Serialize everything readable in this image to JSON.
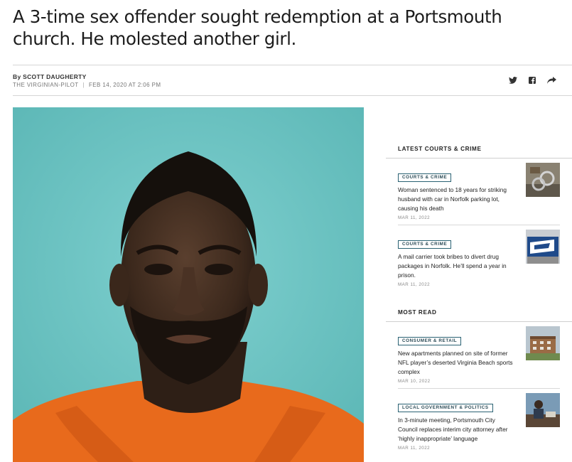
{
  "article": {
    "headline": "A 3-time sex offender sought redemption at a Portsmouth church. He molested another girl.",
    "author": "By SCOTT DAUGHERTY",
    "publication": "THE VIRGINIAN-PILOT",
    "date": "FEB 14, 2020 AT 2:06 PM",
    "share_icons": [
      "twitter-icon",
      "facebook-icon",
      "share-arrow-icon"
    ]
  },
  "sidebar": {
    "latest": {
      "title": "LATEST COURTS & CRIME",
      "items": [
        {
          "tag": "COURTS & CRIME",
          "title": "Woman sentenced to 18 years for striking husband with car in Norfolk parking lot, causing his death",
          "date": "MAR 11, 2022",
          "thumb": "handcuffs-photo"
        },
        {
          "tag": "COURTS & CRIME",
          "title": "A mail carrier took bribes to divert drug packages in Norfolk. He’ll spend a year in prison.",
          "date": "MAR 11, 2022",
          "thumb": "usps-sign-photo"
        }
      ]
    },
    "most_read": {
      "title": "MOST READ",
      "items": [
        {
          "tag": "CONSUMER & RETAIL",
          "title": "New apartments planned on site of former NFL player’s deserted Virginia Beach sports complex",
          "date": "MAR 10, 2022",
          "thumb": "apartments-photo"
        },
        {
          "tag": "LOCAL GOVERNMENT & POLITICS",
          "title": "In 3-minute meeting, Portsmouth City Council replaces interim city attorney after ‘highly inappropriate’ language",
          "date": "MAR 11, 2022",
          "thumb": "council-photo"
        }
      ]
    }
  },
  "colors": {
    "photo_bg": "#6fc4c3",
    "tag_border": "#2a6273",
    "shirt": "#e86a1c"
  }
}
